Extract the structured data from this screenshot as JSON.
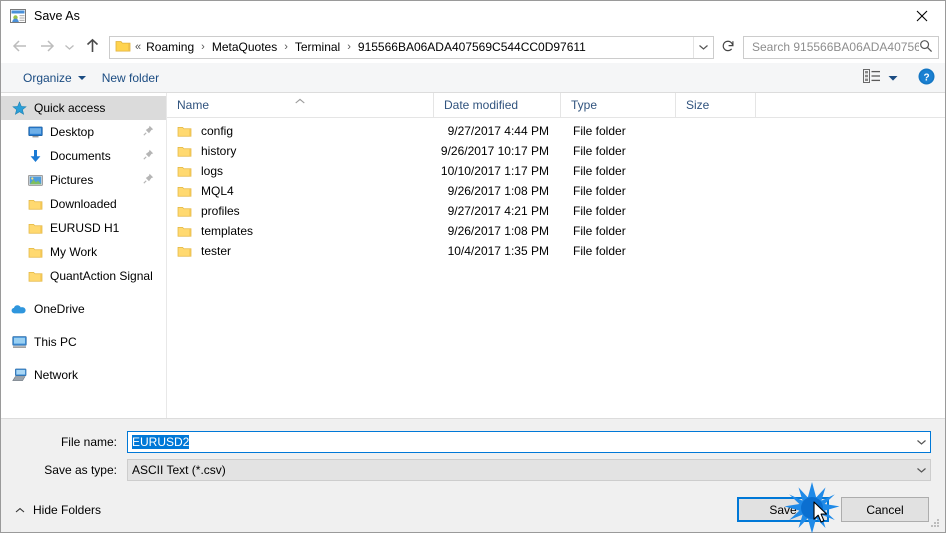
{
  "window": {
    "title": "Save As",
    "icon": "app-icon",
    "close_label": "✕"
  },
  "navbar": {
    "back_icon": "arrow-left-icon",
    "forward_icon": "arrow-right-icon",
    "recent_icon": "chevron-down-icon",
    "up_icon": "arrow-up-icon",
    "folder_icon": "folder-icon",
    "breadcrumb_prefix": "«",
    "breadcrumbs": [
      "Roaming",
      "MetaQuotes",
      "Terminal",
      "915566BA06ADA407569C544CC0D97611"
    ],
    "separator": "›",
    "dropdown_icon": "chevron-down-icon",
    "refresh_icon": "refresh-icon",
    "search_placeholder": "Search 915566BA06ADA40756...",
    "search_value": "",
    "search_icon": "search-icon"
  },
  "cmdbar": {
    "organize_label": "Organize",
    "new_folder_label": "New folder",
    "view_icon": "view-layout-icon",
    "view_caret_icon": "chevron-down-icon",
    "help_icon": "help-icon"
  },
  "sidebar": {
    "items": [
      {
        "label": "Quick access",
        "icon": "star-icon",
        "selected": true,
        "indent": false,
        "pinned": false
      },
      {
        "label": "Desktop",
        "icon": "desktop-icon",
        "selected": false,
        "indent": true,
        "pinned": true
      },
      {
        "label": "Documents",
        "icon": "download-arrow-icon",
        "selected": false,
        "indent": true,
        "pinned": true
      },
      {
        "label": "Pictures",
        "icon": "picture-icon",
        "selected": false,
        "indent": true,
        "pinned": true
      },
      {
        "label": "Downloaded",
        "icon": "folder-icon",
        "selected": false,
        "indent": true,
        "pinned": false
      },
      {
        "label": "EURUSD H1",
        "icon": "folder-icon",
        "selected": false,
        "indent": true,
        "pinned": false
      },
      {
        "label": "My Work",
        "icon": "folder-icon",
        "selected": false,
        "indent": true,
        "pinned": false
      },
      {
        "label": "QuantAction Signal",
        "icon": "folder-icon",
        "selected": false,
        "indent": true,
        "pinned": false
      },
      {
        "label": "OneDrive",
        "icon": "cloud-icon",
        "selected": false,
        "indent": false,
        "pinned": false,
        "gap_before": true
      },
      {
        "label": "This PC",
        "icon": "computer-icon",
        "selected": false,
        "indent": false,
        "pinned": false,
        "gap_before": true
      },
      {
        "label": "Network",
        "icon": "network-icon",
        "selected": false,
        "indent": false,
        "pinned": false,
        "gap_before": true
      }
    ]
  },
  "filelist": {
    "columns": [
      "Name",
      "Date modified",
      "Type",
      "Size"
    ],
    "sort_column": "Name",
    "sort_direction": "ascending",
    "rows": [
      {
        "name": "config",
        "date": "9/27/2017 4:44 PM",
        "type": "File folder",
        "size": ""
      },
      {
        "name": "history",
        "date": "9/26/2017 10:17 PM",
        "type": "File folder",
        "size": ""
      },
      {
        "name": "logs",
        "date": "10/10/2017 1:17 PM",
        "type": "File folder",
        "size": ""
      },
      {
        "name": "MQL4",
        "date": "9/26/2017 1:08 PM",
        "type": "File folder",
        "size": ""
      },
      {
        "name": "profiles",
        "date": "9/27/2017 4:21 PM",
        "type": "File folder",
        "size": ""
      },
      {
        "name": "templates",
        "date": "9/26/2017 1:08 PM",
        "type": "File folder",
        "size": ""
      },
      {
        "name": "tester",
        "date": "10/4/2017 1:35 PM",
        "type": "File folder",
        "size": ""
      }
    ]
  },
  "form": {
    "filename_label": "File name:",
    "filename_value": "EURUSD2",
    "filename_selected": true,
    "filetype_label": "Save as type:",
    "filetype_value": "ASCII Text (*.csv)"
  },
  "buttons": {
    "hide_folders_label": "Hide Folders",
    "hide_folders_icon": "chevron-up-icon",
    "save_label": "Save",
    "cancel_label": "Cancel",
    "resize_grip_icon": "resize-grip-icon"
  },
  "colors": {
    "accent": "#0078d7",
    "folder_yellow": "#ffd34e",
    "header_text": "#30537e",
    "command_text": "#1b4c82",
    "selected_row": "#dbdbdb"
  }
}
